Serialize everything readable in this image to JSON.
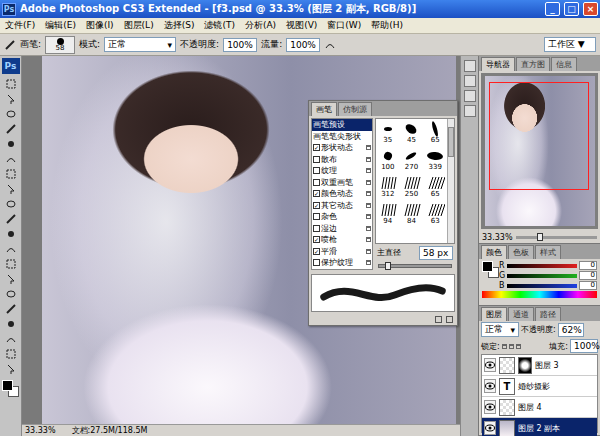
{
  "window": {
    "title": "Adobe Photoshop CS3 Extended - [f3.psd @ 33.3% (图层 2 副本, RGB/8)]",
    "logo": "Ps",
    "buttons": [
      "_",
      "□",
      "×"
    ]
  },
  "menu": [
    "文件(F)",
    "编辑(E)",
    "图像(I)",
    "图层(L)",
    "选择(S)",
    "滤镜(T)",
    "分析(A)",
    "视图(V)",
    "窗口(W)",
    "帮助(H)"
  ],
  "options": {
    "brush_label": "画笔:",
    "brush_size": "58",
    "mode_label": "模式:",
    "mode": "正常",
    "opacity_label": "不透明度:",
    "opacity": "100%",
    "flow_label": "流量:",
    "flow": "100%",
    "workspace": "工作区 ▼"
  },
  "toolbox": {
    "logo": "Ps"
  },
  "brush_panel": {
    "tabs": [
      {
        "label": "画笔",
        "selected": true
      },
      {
        "label": "仿制源",
        "selected": false
      }
    ],
    "settings": [
      {
        "label": "画笔预设",
        "kind": "header",
        "checked": false,
        "selected": true
      },
      {
        "label": "画笔笔尖形状",
        "kind": "header",
        "checked": false,
        "selected": false
      },
      {
        "label": "形状动态",
        "kind": "option",
        "checked": true,
        "selected": false
      },
      {
        "label": "散布",
        "kind": "option",
        "checked": false,
        "selected": false
      },
      {
        "label": "纹理",
        "kind": "option",
        "checked": false,
        "selected": false
      },
      {
        "label": "双重画笔",
        "kind": "option",
        "checked": false,
        "selected": false
      },
      {
        "label": "颜色动态",
        "kind": "option",
        "checked": true,
        "selected": false
      },
      {
        "label": "其它动态",
        "kind": "option",
        "checked": true,
        "selected": false
      },
      {
        "label": "杂色",
        "kind": "option",
        "checked": false,
        "selected": false
      },
      {
        "label": "湿边",
        "kind": "option",
        "checked": false,
        "selected": false
      },
      {
        "label": "喷枪",
        "kind": "option",
        "checked": true,
        "selected": false
      },
      {
        "label": "平滑",
        "kind": "option",
        "checked": true,
        "selected": false
      },
      {
        "label": "保护纹理",
        "kind": "option",
        "checked": false,
        "selected": false
      }
    ],
    "presets": [
      {
        "size": "35"
      },
      {
        "size": "45"
      },
      {
        "size": "65"
      },
      {
        "size": "100"
      },
      {
        "size": "270"
      },
      {
        "size": "339"
      },
      {
        "size": "312"
      },
      {
        "size": "250"
      },
      {
        "size": "65"
      },
      {
        "size": "94"
      },
      {
        "size": "84"
      },
      {
        "size": "63"
      }
    ],
    "diameter_label": "主直径",
    "diameter": "58 px",
    "diameter_level": 0.12
  },
  "navigator": {
    "tabs": [
      {
        "label": "导航器",
        "selected": true
      },
      {
        "label": "直方图",
        "selected": false
      },
      {
        "label": "信息",
        "selected": false
      }
    ],
    "zoom": "33.33%",
    "zoom_level": 0.3
  },
  "color_panel": {
    "tabs": [
      {
        "label": "颜色",
        "selected": true
      },
      {
        "label": "色板",
        "selected": false
      },
      {
        "label": "样式",
        "selected": false
      }
    ],
    "channels": [
      {
        "name": "R",
        "value": "0",
        "color": "#e02020"
      },
      {
        "name": "G",
        "value": "0",
        "color": "#20b020"
      },
      {
        "name": "B",
        "value": "0",
        "color": "#2040e0"
      }
    ]
  },
  "layers_panel": {
    "tabs": [
      {
        "label": "图层",
        "selected": true
      },
      {
        "label": "通道",
        "selected": false
      },
      {
        "label": "路径",
        "selected": false
      }
    ],
    "blend": "正常",
    "opacity_label": "不透明度:",
    "opacity": "62%",
    "lock_label": "锁定:",
    "fill_label": "填充:",
    "fill": "100%",
    "items": [
      {
        "name": "图层 3",
        "kind": "image",
        "thumb": "",
        "mask": true,
        "visible": true,
        "selected": false
      },
      {
        "name": "婚纱摄影",
        "kind": "text",
        "thumb": "T",
        "mask": false,
        "visible": true,
        "selected": false
      },
      {
        "name": "图层 4",
        "kind": "image",
        "thumb": "",
        "mask": false,
        "visible": true,
        "selected": false
      },
      {
        "name": "图层 2 副本",
        "kind": "photo",
        "thumb": "",
        "mask": false,
        "visible": true,
        "selected": true
      }
    ]
  },
  "status_bar": {
    "zoom": "33.33%",
    "document": "文档:27.5M/118.5M"
  }
}
